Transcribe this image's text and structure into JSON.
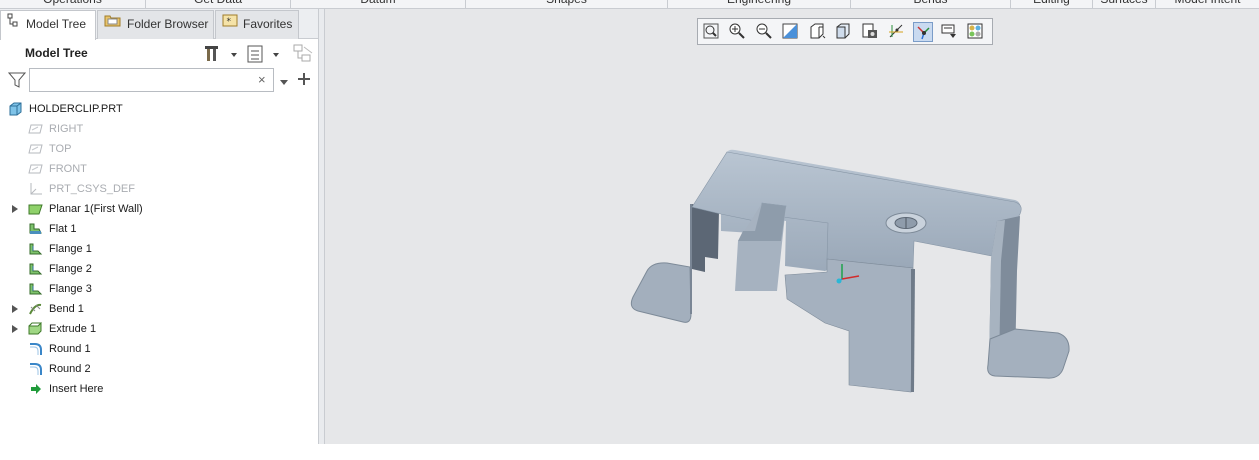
{
  "ribbon": {
    "groups": [
      "Operations",
      "Get Data",
      "Datum",
      "Shapes",
      "Engineering",
      "Bends",
      "Editing",
      "Surfaces",
      "Model Intent"
    ]
  },
  "tabs": [
    {
      "label": "Model Tree",
      "icon": "model-tree-icon",
      "active": true
    },
    {
      "label": "Folder Browser",
      "icon": "folder-browser-icon",
      "active": false
    },
    {
      "label": "Favorites",
      "icon": "favorites-icon",
      "active": false
    }
  ],
  "tree_header": {
    "title": "Model Tree",
    "buttons": [
      "tree-settings-icon",
      "show-menu-icon",
      "tree-filters-icon"
    ]
  },
  "filter": {
    "placeholder": "",
    "value": "",
    "clear_glyph": "×"
  },
  "tree": {
    "root": {
      "label": "HOLDERCLIP.PRT",
      "icon": "part-icon"
    },
    "items": [
      {
        "label": "RIGHT",
        "icon": "datum-plane-icon",
        "dim": true,
        "expandable": false
      },
      {
        "label": "TOP",
        "icon": "datum-plane-icon",
        "dim": true,
        "expandable": false
      },
      {
        "label": "FRONT",
        "icon": "datum-plane-icon",
        "dim": true,
        "expandable": false
      },
      {
        "label": "PRT_CSYS_DEF",
        "icon": "csys-icon",
        "dim": true,
        "expandable": false
      },
      {
        "label": "Planar 1(First Wall)",
        "icon": "planar-wall-icon",
        "dim": false,
        "expandable": true
      },
      {
        "label": "Flat 1",
        "icon": "flat-wall-icon",
        "dim": false,
        "expandable": false
      },
      {
        "label": "Flange 1",
        "icon": "flange-wall-icon",
        "dim": false,
        "expandable": false
      },
      {
        "label": "Flange 2",
        "icon": "flange-wall-icon",
        "dim": false,
        "expandable": false
      },
      {
        "label": "Flange 3",
        "icon": "flange-wall-icon",
        "dim": false,
        "expandable": false
      },
      {
        "label": "Bend 1",
        "icon": "bend-icon",
        "dim": false,
        "expandable": true
      },
      {
        "label": "Extrude 1",
        "icon": "extrude-icon",
        "dim": false,
        "expandable": true
      },
      {
        "label": "Round 1",
        "icon": "round-icon",
        "dim": false,
        "expandable": false
      },
      {
        "label": "Round 2",
        "icon": "round-icon",
        "dim": false,
        "expandable": false
      },
      {
        "label": "Insert Here",
        "icon": "insert-here-arrow-icon",
        "dim": false,
        "expandable": false
      }
    ]
  },
  "view_toolbar": {
    "buttons": [
      {
        "name": "refit-icon",
        "active": false
      },
      {
        "name": "zoom-in-icon",
        "active": false
      },
      {
        "name": "zoom-out-icon",
        "active": false
      },
      {
        "name": "repaint-icon",
        "active": false
      },
      {
        "name": "display-style-icon",
        "active": false
      },
      {
        "name": "saved-orientations-icon",
        "active": false
      },
      {
        "name": "view-manager-icon",
        "active": false
      },
      {
        "name": "datum-display-filters-icon",
        "active": false
      },
      {
        "name": "spin-center-icon",
        "active": true
      },
      {
        "name": "annotation-display-icon",
        "active": false
      },
      {
        "name": "appearance-gallery-icon",
        "active": false
      }
    ]
  },
  "colors": {
    "panel_border": "#c9ccd1",
    "viewport_bg": "#e6e7e9",
    "model_light": "#a9b6c4",
    "model_dark": "#5b6673",
    "model_mid": "#8795a4"
  }
}
